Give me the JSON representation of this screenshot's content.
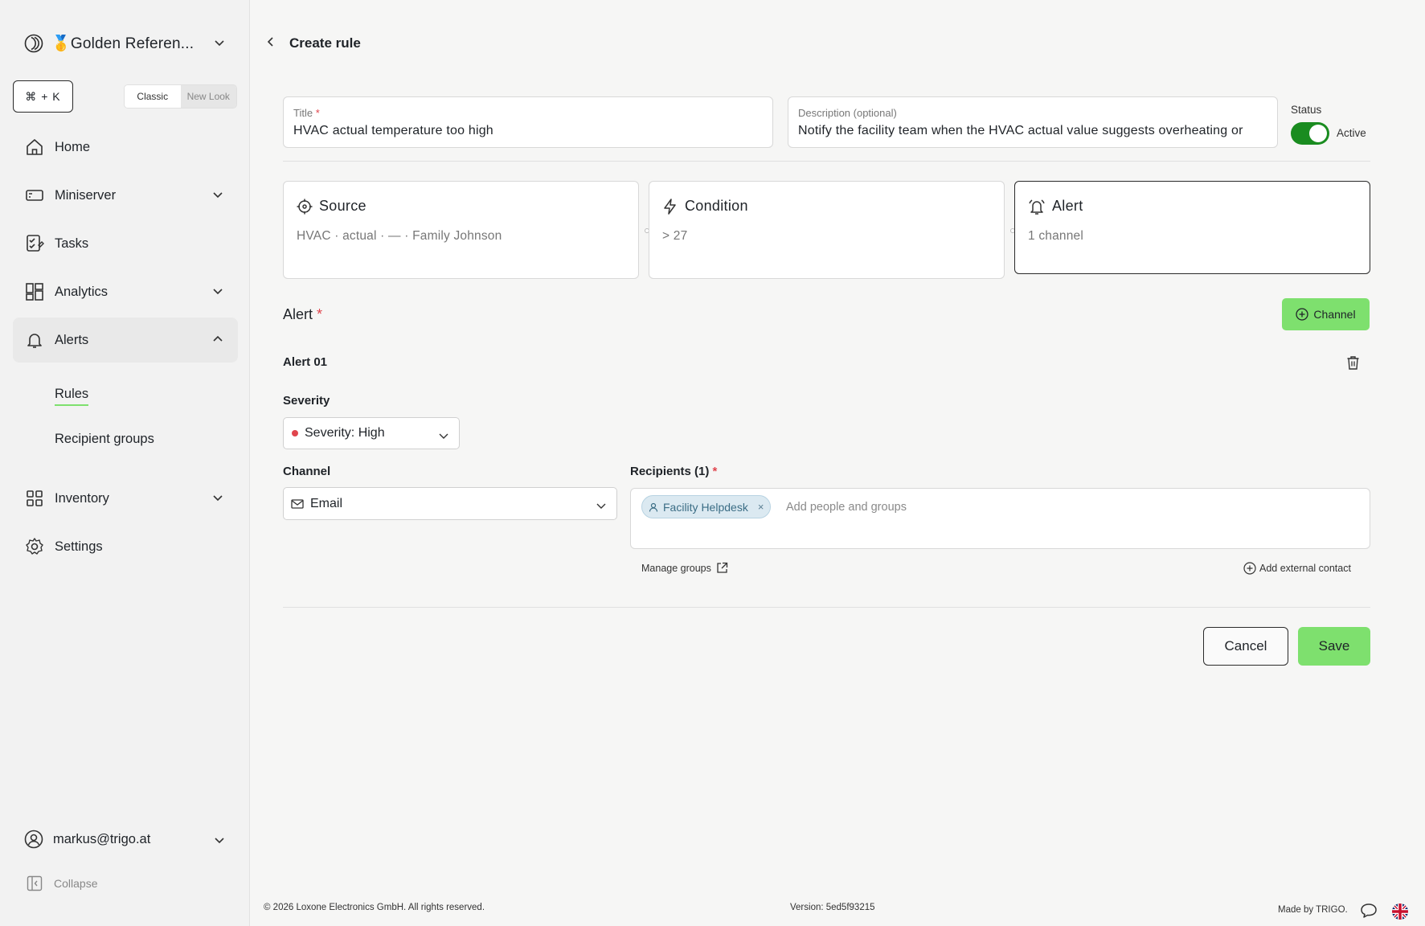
{
  "workspace": {
    "name": "🥇Golden Referen..."
  },
  "sidebar": {
    "cmdk": "⌘ + K",
    "look_toggle": {
      "classic": "Classic",
      "new_look": "New Look"
    },
    "items": [
      {
        "label": "Home"
      },
      {
        "label": "Miniserver"
      },
      {
        "label": "Tasks"
      },
      {
        "label": "Analytics"
      },
      {
        "label": "Alerts"
      },
      {
        "label": "Inventory"
      },
      {
        "label": "Settings"
      }
    ],
    "alerts_sub": {
      "rules": "Rules",
      "recipient_groups": "Recipient groups"
    },
    "user": "markus@trigo.at",
    "collapse": "Collapse"
  },
  "page": {
    "title": "Create rule",
    "title_field": {
      "label": "Title",
      "required_mark": "*",
      "value": "HVAC actual temperature too high"
    },
    "description_field": {
      "label": "Description (optional)",
      "value": "Notify the facility team when the HVAC actual value suggests overheating or"
    },
    "status": {
      "label": "Status",
      "value": "Active",
      "on": true
    },
    "steps": [
      {
        "title": "Source",
        "subtitle": "HVAC · actual · — · Family Johnson"
      },
      {
        "title": "Condition",
        "subtitle": "> 27"
      },
      {
        "title": "Alert",
        "subtitle": "1 channel"
      }
    ],
    "alert_section": {
      "title": "Alert",
      "required_mark": "*",
      "add_channel_label": "Channel"
    },
    "alert": {
      "name": "Alert 01",
      "severity_label": "Severity",
      "severity_value": "Severity: High",
      "channel_label": "Channel",
      "channel_value": "Email",
      "recipients_label": "Recipients (1)",
      "recipients_required_mark": "*",
      "recipient_chip": "Facility Helpdesk",
      "chip_remove": "×",
      "recipients_placeholder": "Add people and groups",
      "manage_groups": "Manage groups",
      "add_external": "Add external contact"
    },
    "actions": {
      "cancel": "Cancel",
      "save": "Save"
    }
  },
  "footer": {
    "copyright": "© 2026 Loxone Electronics GmbH. All rights reserved.",
    "version": "Version: 5ed5f93215",
    "made_by": "Made by TRIGO."
  },
  "colors": {
    "accent": "#7ee06e",
    "toggle_on": "#1a8c20",
    "required": "#e0454d",
    "chip_bg": "#dbe9f1"
  }
}
